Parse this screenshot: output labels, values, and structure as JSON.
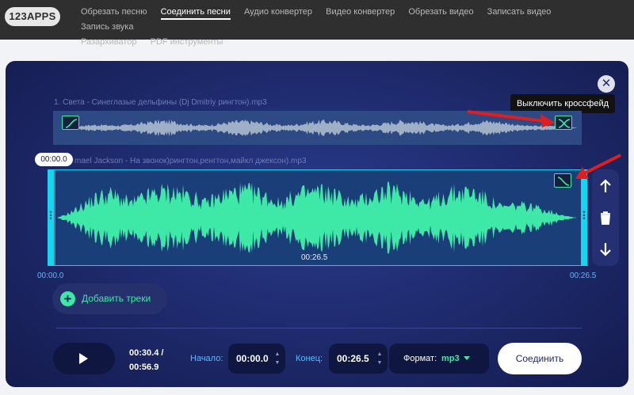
{
  "brand": {
    "logo": "123APPS"
  },
  "nav": {
    "items": [
      {
        "label": "Обрезать песню",
        "active": false
      },
      {
        "label": "Соединить песни",
        "active": true
      },
      {
        "label": "Аудио конвертер",
        "active": false
      },
      {
        "label": "Видео конвертер",
        "active": false
      },
      {
        "label": "Обрезать видео",
        "active": false
      },
      {
        "label": "Записать видео",
        "active": false
      },
      {
        "label": "Запись звука",
        "active": false
      },
      {
        "label": "Разархиватор",
        "active": false
      },
      {
        "label": "PDF инструменты",
        "active": false
      }
    ]
  },
  "editor": {
    "close_icon": "close-icon",
    "tooltip": "Выключить кроссфейд",
    "tracks": [
      {
        "title": "1. Света - Синеглазые дельфины (Dj Dmitriy рингтон).mp3"
      },
      {
        "title": "mael Jackson - На звонок)рингтон,ренгтон,майкл джексон).mp3",
        "position_badge": "00:00.0",
        "duration_label": "00:26.5",
        "start_time": "00:00.0",
        "end_time": "00:26.5"
      }
    ],
    "side_controls": {
      "up_icon": "arrow-up-icon",
      "delete_icon": "trash-icon",
      "down_icon": "arrow-down-icon"
    },
    "add_tracks": {
      "label": "Добавить треки",
      "icon": "plus-circle-icon"
    }
  },
  "player": {
    "play_icon": "play-icon",
    "position": "00:30.4 /",
    "total": "00:56.9",
    "start_label": "Начало:",
    "start_value": "00:00.0",
    "end_label": "Конец:",
    "end_value": "00:26.5",
    "format_label": "Формат:",
    "format_value": "mp3",
    "join_label": "Соединить"
  },
  "colors": {
    "accent_green": "#3ee8a6",
    "selection_cyan": "#12d7f0",
    "card_blue": "#1f2c70",
    "time_blue": "#5fb8ff",
    "annotation_red": "#e11d1d"
  }
}
